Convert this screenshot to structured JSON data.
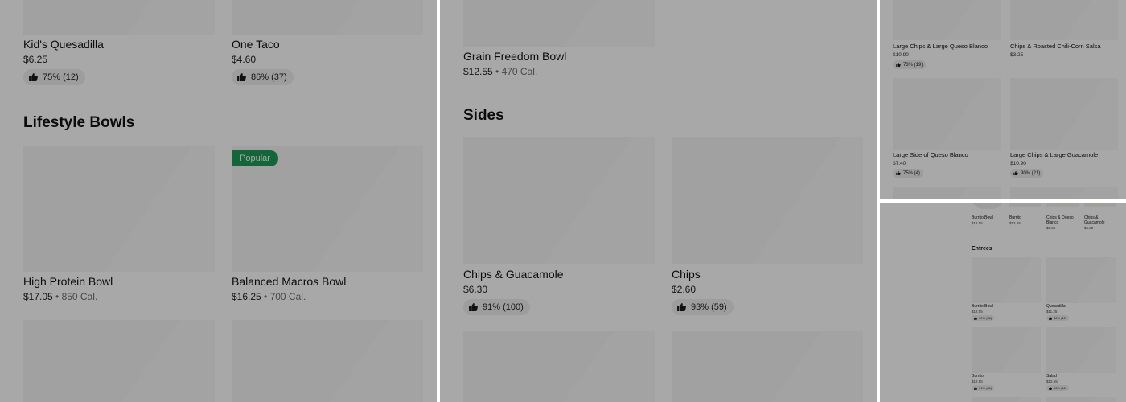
{
  "colors": {
    "popular_badge": "#1f9b55",
    "overlay": "rgba(0,0,0,0.34)"
  },
  "panel1": {
    "items_top": [
      {
        "name": "Kid's Quesadilla",
        "price": "$6.25",
        "rating": "75% (12)"
      },
      {
        "name": "One Taco",
        "price": "$4.60",
        "rating": "86% (37)"
      }
    ],
    "section_title": "Lifestyle Bowls",
    "badge": "Popular",
    "items_bowls": [
      {
        "name": "High Protein Bowl",
        "price": "$17.05",
        "calories": "850 Cal."
      },
      {
        "name": "Balanced Macros Bowl",
        "price": "$16.25",
        "calories": "700 Cal."
      }
    ]
  },
  "panel2": {
    "item_top": {
      "name": "Grain Freedom Bowl",
      "price": "$12.55",
      "calories": "470 Cal."
    },
    "section_title": "Sides",
    "items": [
      {
        "name": "Chips & Guacamole",
        "price": "$6.30",
        "rating": "91% (100)"
      },
      {
        "name": "Chips",
        "price": "$2.60",
        "rating": "93% (59)"
      }
    ]
  },
  "panel3": {
    "items": [
      {
        "name": "Large Chips & Large Queso Blanco",
        "price": "$10.90",
        "rating": "73% (19)"
      },
      {
        "name": "Chips & Roasted Chili-Corn Salsa",
        "price": "$3.25"
      },
      {
        "name": "Large Side of Queso Blanco",
        "price": "$7.40",
        "rating": "75% (4)"
      },
      {
        "name": "Large Chips & Large Guacamole",
        "price": "$10.90",
        "rating": "90% (21)"
      }
    ]
  },
  "panel4": {
    "carousel": [
      {
        "name": "Burrito Bowl",
        "price": "$12.55"
      },
      {
        "name": "Burrito",
        "price": "$12.55"
      },
      {
        "name": "Chips & Queso Blanco",
        "price": "$6.50"
      },
      {
        "name": "Chips & Guacamole",
        "price": "$6.30"
      }
    ],
    "section_title": "Entrees",
    "items": [
      {
        "name": "Burrito Bowl",
        "price": "$12.55",
        "rating": "90% (56)"
      },
      {
        "name": "Quesadilla",
        "price": "$11.25",
        "rating": "88% (10)"
      },
      {
        "name": "Burrito",
        "price": "$12.55",
        "rating": "91% (89)"
      },
      {
        "name": "Salad",
        "price": "$12.55",
        "rating": "96% (10)"
      }
    ]
  }
}
